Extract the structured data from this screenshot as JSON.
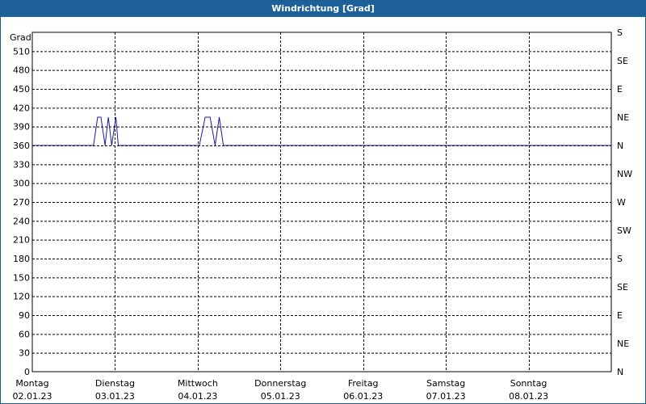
{
  "window": {
    "title": "Windrichtung [Grad]"
  },
  "chart_data": {
    "type": "line",
    "title": "Windrichtung [Grad]",
    "ylabel": "Grad",
    "ylim": [
      0,
      540
    ],
    "yticks": [
      0,
      30,
      60,
      90,
      120,
      150,
      180,
      210,
      240,
      270,
      300,
      330,
      360,
      390,
      420,
      450,
      480,
      510
    ],
    "right_axis": {
      "labels": [
        "N",
        "NE",
        "E",
        "SE",
        "S",
        "SW",
        "W",
        "NW",
        "N",
        "NE",
        "E",
        "SE",
        "S"
      ]
    },
    "x_labels": [
      {
        "day": "Montag",
        "date": "02.01.23"
      },
      {
        "day": "Dienstag",
        "date": "03.01.23"
      },
      {
        "day": "Mittwoch",
        "date": "04.01.23"
      },
      {
        "day": "Donnerstag",
        "date": "05.01.23"
      },
      {
        "day": "Freitag",
        "date": "06.01.23"
      },
      {
        "day": "Samstag",
        "date": "07.01.23"
      },
      {
        "day": "Sonntag",
        "date": "08.01.23"
      }
    ],
    "xlim": [
      0,
      7
    ],
    "grid": true,
    "colors": {
      "line": "#1a1a9e",
      "grid": "#000000"
    },
    "series": [
      {
        "x": [
          0,
          0.74,
          0.79,
          0.83,
          0.88,
          0.92,
          0.96,
          1.01,
          1.04,
          1.08,
          2.02,
          2.09,
          2.15,
          2.21,
          2.26,
          2.31,
          2.36,
          7
        ],
        "y": [
          360,
          360,
          405,
          405,
          360,
          405,
          360,
          405,
          360,
          360,
          360,
          405,
          405,
          360,
          405,
          360,
          360,
          360
        ]
      }
    ]
  }
}
